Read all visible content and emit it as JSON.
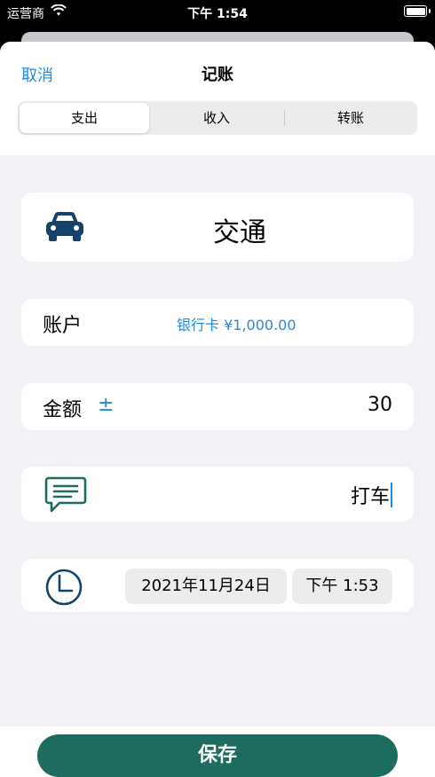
{
  "status_bar": {
    "carrier": "运营商",
    "time": "下午 1:54"
  },
  "header": {
    "cancel_label": "取消",
    "title": "记账"
  },
  "segments": [
    {
      "label": "支出",
      "selected": true
    },
    {
      "label": "收入",
      "selected": false
    },
    {
      "label": "转账",
      "selected": false
    }
  ],
  "category": {
    "label": "交通",
    "icon": "car-icon"
  },
  "account": {
    "label": "账户",
    "value": "银行卡  ¥1,000.00"
  },
  "amount": {
    "label": "金额",
    "toggle_symbol": "±",
    "value": "30"
  },
  "note": {
    "value": "打车",
    "icon": "message-icon"
  },
  "datetime": {
    "date": "2021年11月24日",
    "time": "下午 1:53",
    "icon": "clock-icon"
  },
  "save_label": "保存",
  "colors": {
    "accent": "#1d8ce0",
    "icon_dark": "#14426a",
    "icon_green": "#1e6b60",
    "save_button": "#1e6b60",
    "background": "#f1f1f6"
  }
}
